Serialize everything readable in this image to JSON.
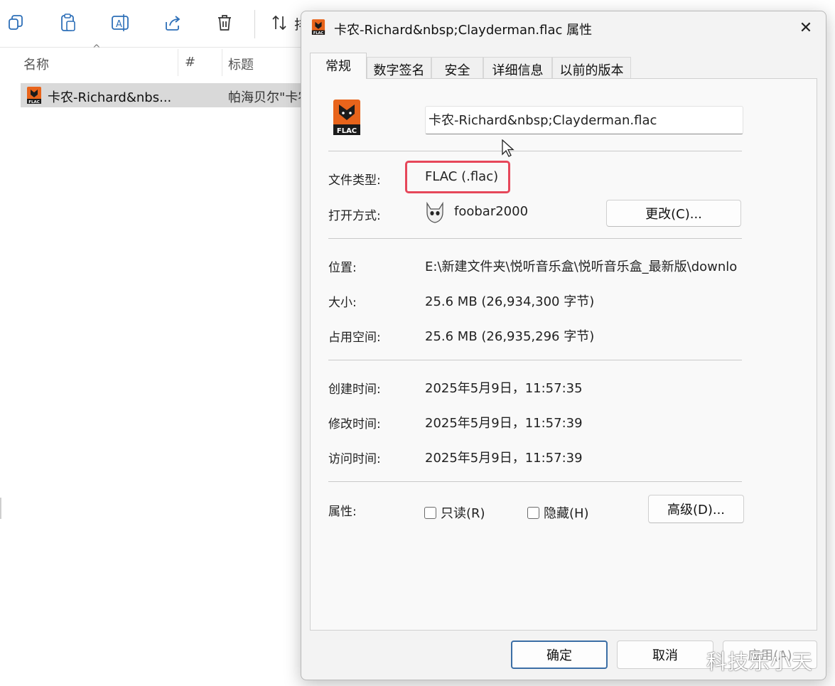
{
  "explorer": {
    "toolbar": {
      "sort_label": "排",
      "icons": [
        "copy-icon",
        "paste-icon",
        "rename-icon",
        "share-icon",
        "delete-icon",
        "sort-icon"
      ]
    },
    "columns": {
      "name": "名称",
      "number": "#",
      "title": "标题"
    },
    "file": {
      "name": "卡农-Richard&nbs...",
      "title": "帕海贝尔\"卡农"
    }
  },
  "dialog": {
    "title": "卡农-Richard&nbsp;Clayderman.flac 属性",
    "tabs": [
      {
        "label": "常规",
        "active": true
      },
      {
        "label": "数字签名",
        "active": false
      },
      {
        "label": "安全",
        "active": false
      },
      {
        "label": "详细信息",
        "active": false
      },
      {
        "label": "以前的版本",
        "active": false
      }
    ],
    "file_name": "卡农-Richard&nbsp;Clayderman.flac",
    "icon_label": "FLAC",
    "file_type": {
      "label": "文件类型:",
      "value": "FLAC (.flac)"
    },
    "opens_with": {
      "label": "打开方式:",
      "value": "foobar2000",
      "change_button": "更改(C)..."
    },
    "location": {
      "label": "位置:",
      "value": "E:\\新建文件夹\\悦听音乐盒\\悦听音乐盒_最新版\\downlo"
    },
    "size": {
      "label": "大小:",
      "value": "25.6 MB (26,934,300 字节)"
    },
    "size_on_disk": {
      "label": "占用空间:",
      "value": "25.6 MB (26,935,296 字节)"
    },
    "created": {
      "label": "创建时间:",
      "value": "2025年5月9日，11:57:35"
    },
    "modified": {
      "label": "修改时间:",
      "value": "2025年5月9日，11:57:39"
    },
    "accessed": {
      "label": "访问时间:",
      "value": "2025年5月9日，11:57:39"
    },
    "attributes": {
      "label": "属性:",
      "readonly": {
        "label": "只读(R)",
        "checked": false
      },
      "hidden": {
        "label": "隐藏(H)",
        "checked": false
      },
      "advanced_button": "高级(D)..."
    },
    "footer": {
      "ok": "确定",
      "cancel": "取消",
      "apply": "应用(A)"
    }
  },
  "watermark": "科技乐小天",
  "colors": {
    "highlight_box": "#e6475a",
    "flac_icon_orange": "#e8641b",
    "primary_button_border": "#3b6ea5"
  }
}
